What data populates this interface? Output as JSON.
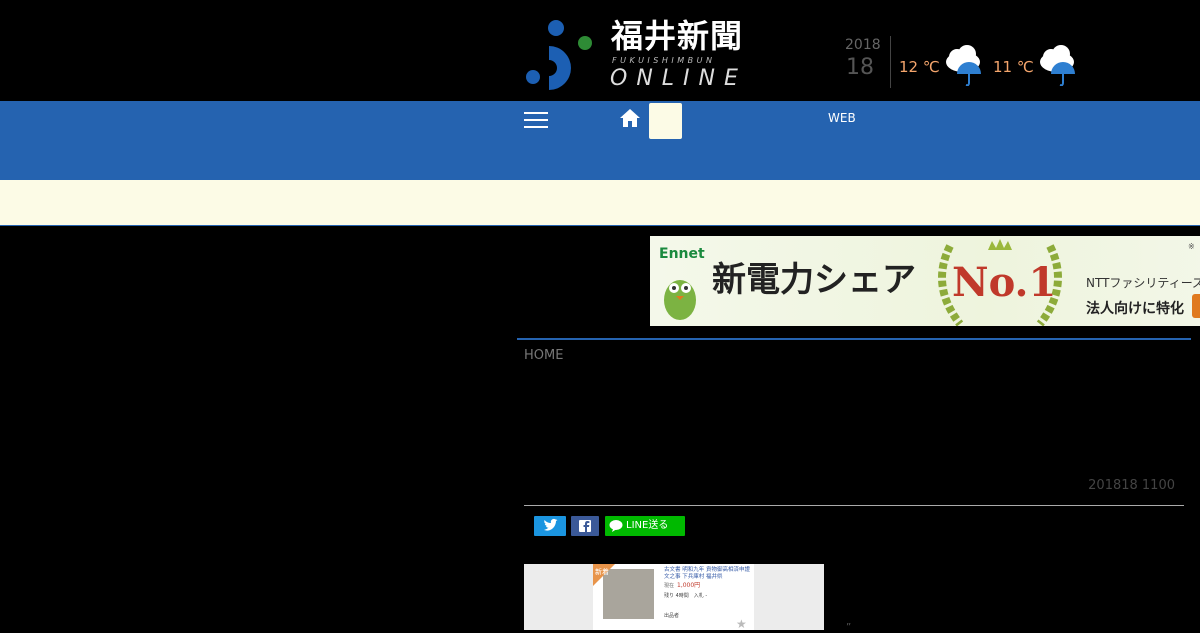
{
  "header": {
    "logo": {
      "title": "福井新聞",
      "roman": "FUKUISHIMBUN",
      "online": "ONLINE"
    },
    "date": {
      "year": "2018",
      "day": "18"
    },
    "weather": [
      {
        "temp": "12 ℃",
        "icon": "rain-cloud-icon"
      },
      {
        "temp": "11 ℃",
        "icon": "rain-cloud-icon"
      }
    ]
  },
  "nav": {
    "menu_icon": "hamburger-menu-icon",
    "home_icon": "home-icon",
    "search_value": "",
    "web_label": "WEB"
  },
  "ad": {
    "brand": "Ennet",
    "headline": "新電力シェア",
    "badge": "No.1",
    "company": "NTTファシリティーズ、東",
    "tagline": "法人向けに特化",
    "note": "※"
  },
  "article": {
    "breadcrumb": "HOME",
    "timestamp": "201818 1100",
    "share": {
      "twitter_icon": "twitter-icon",
      "facebook_icon": "facebook-icon",
      "line_label": "LINE送る"
    },
    "image": {
      "corner_label": "新着",
      "title": "古文書 明和九年 貢物御高相済申證文之事 下兵庫村 福井県",
      "price_label": "現在",
      "price": "1,000円",
      "remaining": "残り 4時間　入札 -",
      "seller": "出品者"
    },
    "caption_tail": "”"
  },
  "colors": {
    "nav_blue": "#2563b0",
    "subnav_cream": "#fcfbe6",
    "temp_orange": "#f4a56c",
    "line_green": "#00b900",
    "twitter_blue": "#1b95e0",
    "facebook_blue": "#3b5998"
  }
}
